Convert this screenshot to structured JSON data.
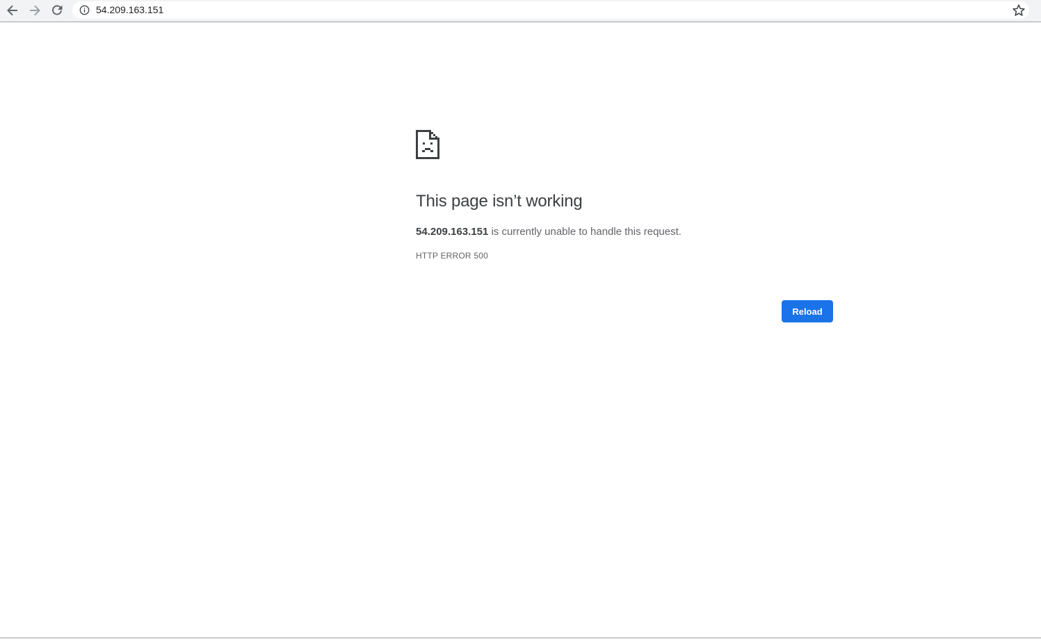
{
  "toolbar": {
    "url": "54.209.163.151",
    "back_icon": "arrow-left-icon",
    "forward_icon": "arrow-right-icon",
    "reload_icon": "reload-icon",
    "info_icon": "info-icon",
    "bookmark_icon": "star-icon"
  },
  "error": {
    "icon": "sad-page-icon",
    "title": "This page isn’t working",
    "host": "54.209.163.151",
    "description_rest": " is currently unable to handle this request.",
    "code": "HTTP ERROR 500",
    "reload_label": "Reload"
  },
  "colors": {
    "accent": "#1a73e8",
    "title": "#3c4043",
    "text": "#5f6368",
    "toolbar_bg": "#f1f3f4"
  }
}
